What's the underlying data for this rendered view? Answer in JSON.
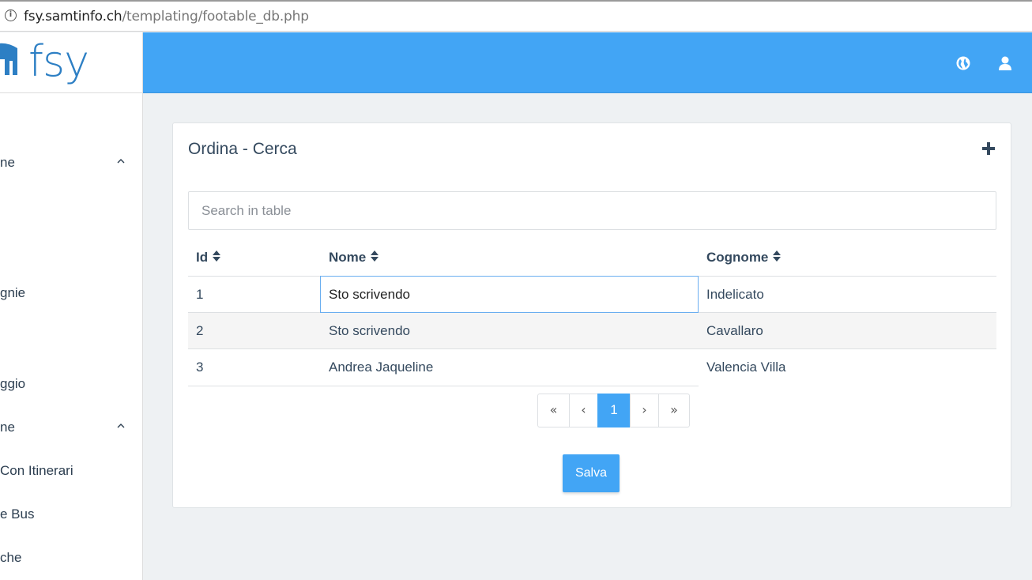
{
  "browser": {
    "url_host": "fsy.samtinfo.ch",
    "url_path": "/templating/footable_db.php"
  },
  "brand": {
    "logo_text": "fsy"
  },
  "header": {
    "icons": [
      "globe-icon",
      "user-icon"
    ]
  },
  "sidebar": {
    "items": [
      {
        "label": "ne",
        "has_chevron": true
      },
      {
        "label": "gnie"
      },
      {
        "label": "ggio"
      },
      {
        "label": "ne",
        "has_chevron": true
      },
      {
        "label": "Con Itinerari"
      },
      {
        "label": "e Bus"
      },
      {
        "label": "che"
      }
    ]
  },
  "card": {
    "title": "Ordina - Cerca",
    "search_placeholder": "Search in table",
    "columns": [
      "Id",
      "Nome",
      "Cognome"
    ],
    "rows": [
      {
        "id": "1",
        "nome": "Sto scrivendo",
        "cognome": "Indelicato",
        "editing": true
      },
      {
        "id": "2",
        "nome": "Sto scrivendo",
        "cognome": "Cavallaro"
      },
      {
        "id": "3",
        "nome": "Andrea Jaqueline",
        "cognome": "Valencia Villa"
      }
    ],
    "pagination": {
      "first": "«",
      "prev": "‹",
      "current": "1",
      "next": "›",
      "last": "»"
    },
    "save_label": "Salva"
  },
  "colors": {
    "accent": "#42a5f5",
    "text": "#34495e",
    "background": "#eef1f3"
  }
}
